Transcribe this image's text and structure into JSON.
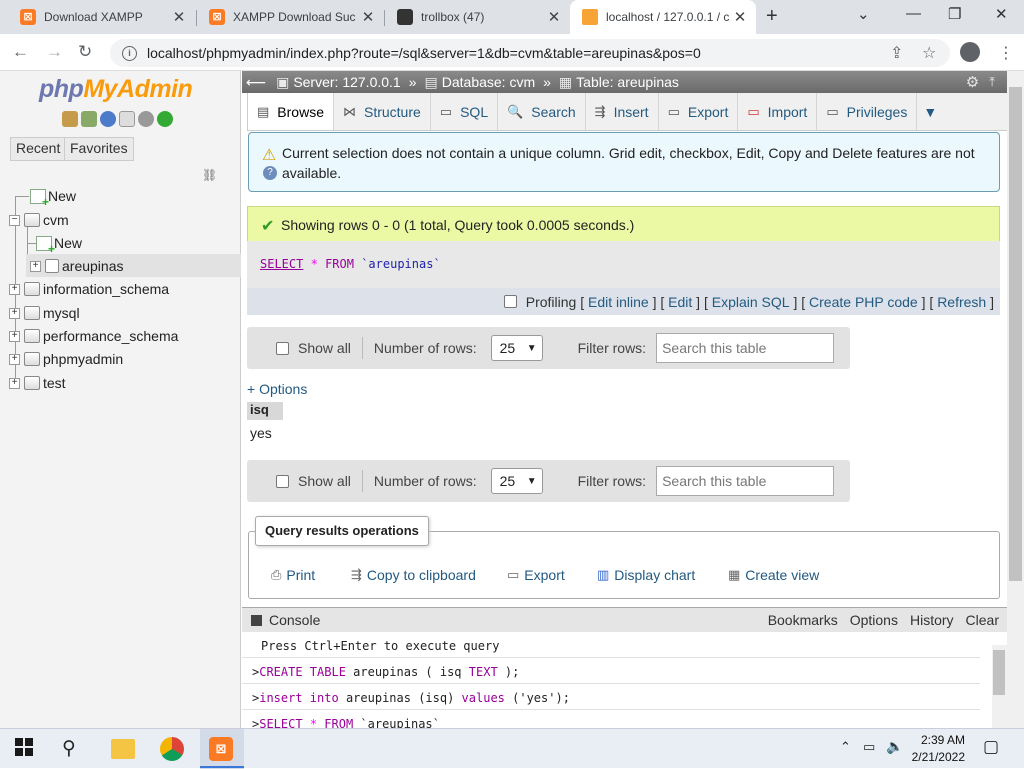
{
  "browser": {
    "tabs": [
      {
        "title": "Download XAMPP",
        "active": false
      },
      {
        "title": "XAMPP Download Suc",
        "active": false
      },
      {
        "title": "trollbox (47)",
        "active": false
      },
      {
        "title": "localhost / 127.0.0.1 / c",
        "active": true
      }
    ],
    "url": "localhost/phpmyadmin/index.php?route=/sql&server=1&db=cvm&table=areupinas&pos=0"
  },
  "sidebar": {
    "logo_php": "php",
    "logo_myadmin": "MyAdmin",
    "recent_label": "Recent",
    "favorites_label": "Favorites",
    "tree": {
      "new": "New",
      "cvm": "cvm",
      "cvm_new": "New",
      "areupinas": "areupinas",
      "information_schema": "information_schema",
      "mysql": "mysql",
      "performance_schema": "performance_schema",
      "phpmyadmin": "phpmyadmin",
      "test": "test"
    }
  },
  "breadcrumb": {
    "server": "Server: 127.0.0.1",
    "database": "Database: cvm",
    "table": "Table: areupinas",
    "sep": "»"
  },
  "tabs": {
    "browse": "Browse",
    "structure": "Structure",
    "sql": "SQL",
    "search": "Search",
    "insert": "Insert",
    "export": "Export",
    "import": "Import",
    "privileges": "Privileges"
  },
  "warning": "Current selection does not contain a unique column. Grid edit, checkbox, Edit, Copy and Delete features are not available.",
  "success": "Showing rows 0 - 0 (1 total, Query took 0.0005 seconds.)",
  "query": {
    "select": "SELECT",
    "star": "*",
    "from": "FROM",
    "table": "`areupinas`"
  },
  "query_links": {
    "profiling": "Profiling",
    "edit_inline": "Edit inline",
    "edit": "Edit",
    "explain": "Explain SQL",
    "php_code": "Create PHP code",
    "refresh": "Refresh"
  },
  "nav": {
    "show_all": "Show all",
    "number_of_rows": "Number of rows:",
    "rows_value": "25",
    "filter_rows": "Filter rows:",
    "search_placeholder": "Search this table"
  },
  "options_link": "+ Options",
  "results": {
    "columns": [
      "isq"
    ],
    "rows": [
      [
        "yes"
      ]
    ]
  },
  "qro": {
    "legend": "Query results operations",
    "print": "Print",
    "copy": "Copy to clipboard",
    "export": "Export",
    "chart": "Display chart",
    "view": "Create view"
  },
  "console": {
    "title": "Console",
    "bookmarks": "Bookmarks",
    "options": "Options",
    "history": "History",
    "clear": "Clear",
    "hint": "Press Ctrl+Enter to execute query",
    "line1_kw": "CREATE TABLE",
    "line1_rest": " areupinas ( isq ",
    "line1_type": "TEXT",
    "line1_end": " );",
    "line2_kw": "insert into",
    "line2_rest": " areupinas (isq) ",
    "line2_kw2": "values",
    "line2_end": " ('yes');",
    "line3_kw": "SELECT",
    "line3_star": " * ",
    "line3_kw2": "FROM",
    "line3_end": " `areupinas`"
  },
  "taskbar": {
    "time": "2:39 AM",
    "date": "2/21/2022"
  },
  "colors": {
    "link": "#235a81",
    "accent_orange": "#fb7a24",
    "success_bg": "#ebf8a4",
    "warning_bg": "#ebf8fd"
  }
}
